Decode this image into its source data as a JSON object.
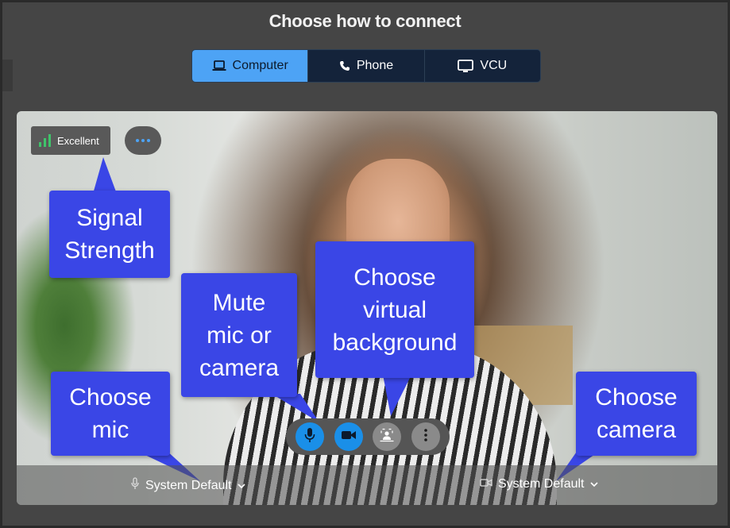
{
  "page": {
    "title": "Choose how to connect"
  },
  "tabs": [
    {
      "label": "Computer",
      "icon": "laptop-icon",
      "active": true
    },
    {
      "label": "Phone",
      "icon": "phone-icon",
      "active": false
    },
    {
      "label": "VCU",
      "icon": "monitor-icon",
      "active": false
    }
  ],
  "signal": {
    "label": "Excellent",
    "icon": "signal-bars-icon",
    "bar_color": "#3fc46a"
  },
  "more_menu": {
    "icon": "more-dots-icon"
  },
  "controls": [
    {
      "name": "mute-mic-button",
      "icon": "microphone-icon"
    },
    {
      "name": "mute-camera-button",
      "icon": "video-camera-icon"
    },
    {
      "name": "virtual-background-button",
      "icon": "virtual-background-icon"
    },
    {
      "name": "more-options-button",
      "icon": "vertical-dots-icon"
    }
  ],
  "mic_select": {
    "value": "System Default",
    "icon": "microphone-icon"
  },
  "camera_select": {
    "value": "System Default",
    "icon": "camera-icon"
  },
  "callouts": {
    "signal": {
      "line1": "Signal",
      "line2": "Strength"
    },
    "mute": {
      "line1": "Mute",
      "line2": "mic or",
      "line3": "camera"
    },
    "virtual": {
      "line1": "Choose",
      "line2": "virtual",
      "line3": "background"
    },
    "mic": {
      "line1": "Choose",
      "line2": "mic"
    },
    "camera": {
      "line1": "Choose",
      "line2": "camera"
    }
  },
  "colors": {
    "accent": "#4da3f5",
    "callout": "#3a46e6",
    "tab_bar": "#14233a",
    "control_blue": "#1a8fe8"
  }
}
